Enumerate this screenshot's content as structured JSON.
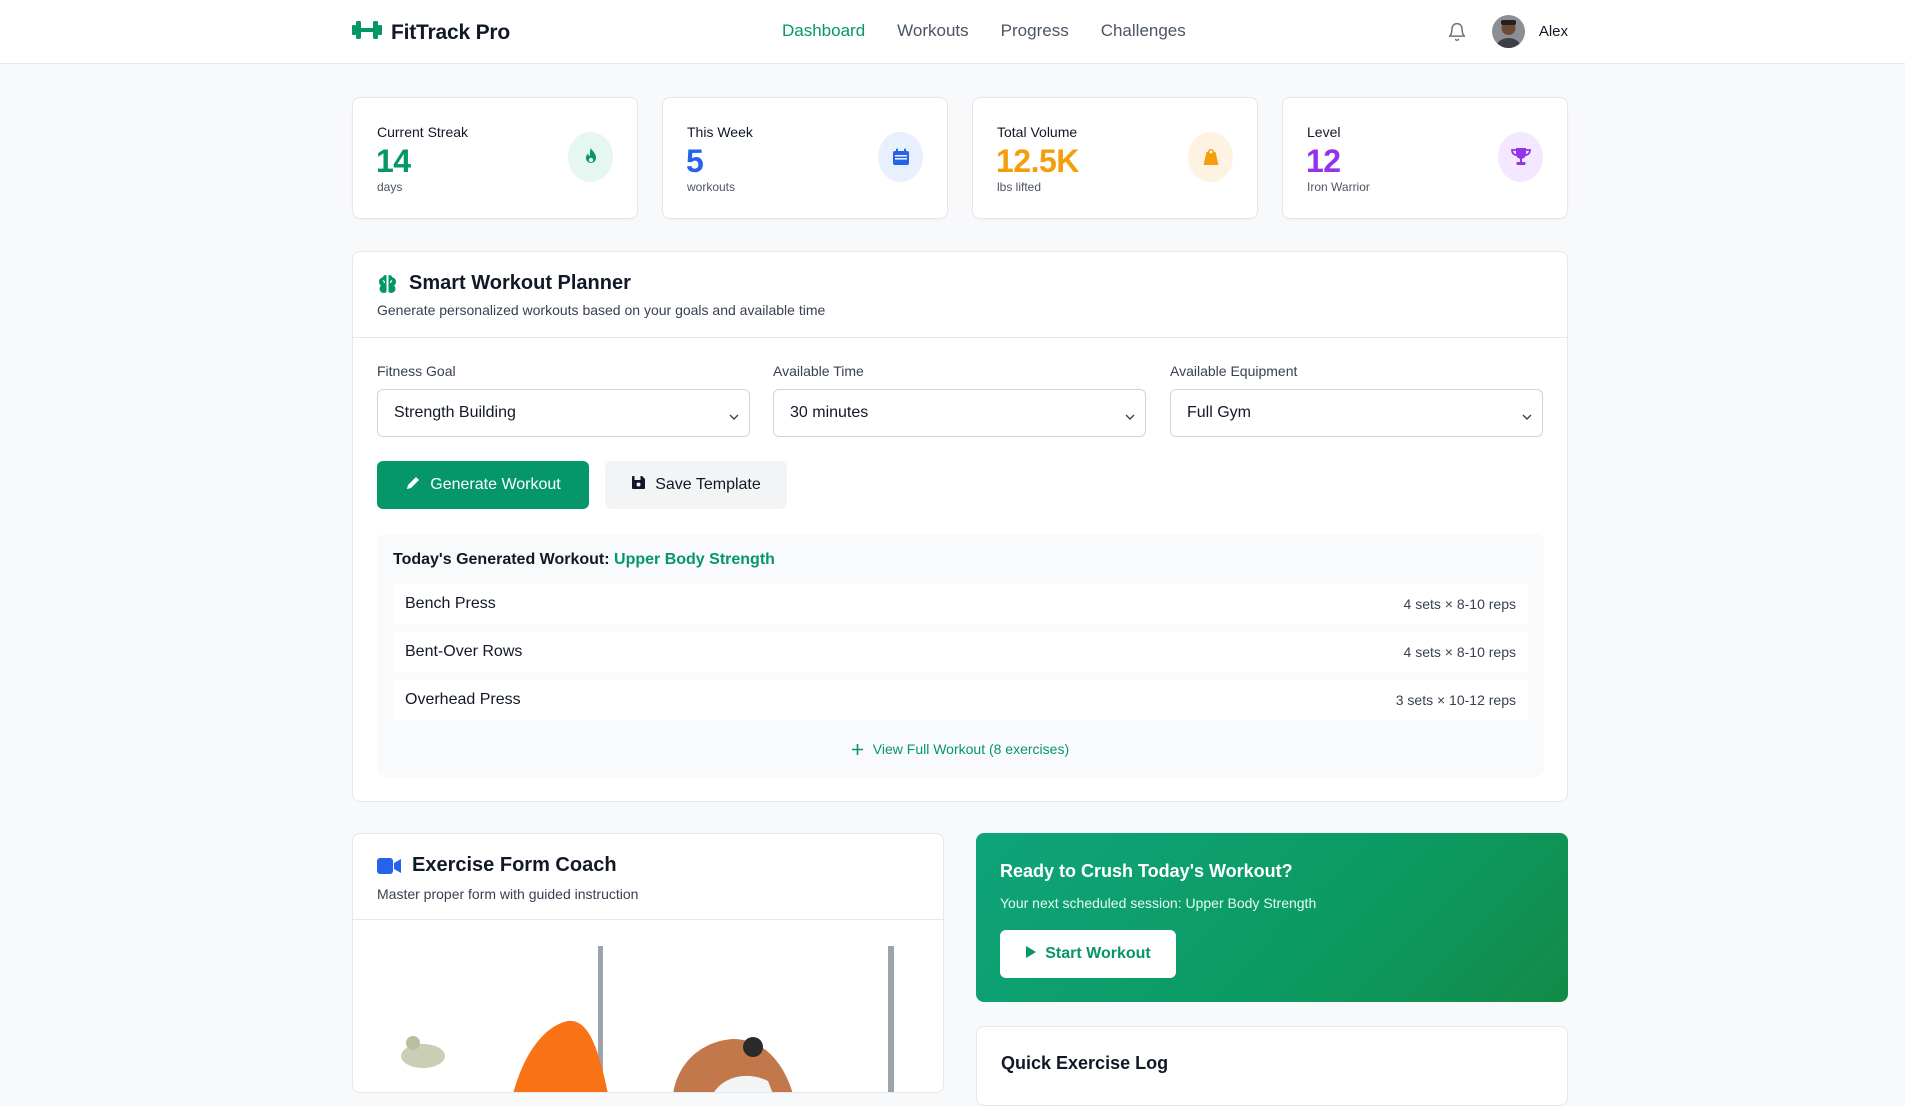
{
  "app": {
    "brand": "FitTrack Pro",
    "nav": [
      {
        "label": "Dashboard",
        "active": true
      },
      {
        "label": "Workouts",
        "active": false
      },
      {
        "label": "Progress",
        "active": false
      },
      {
        "label": "Challenges",
        "active": false
      }
    ],
    "user": {
      "name": "Alex"
    }
  },
  "stats": [
    {
      "label": "Current Streak",
      "value": "14",
      "unit": "days",
      "color": "#059669",
      "icon": "flame-icon"
    },
    {
      "label": "This Week",
      "value": "5",
      "unit": "workouts",
      "color": "#2563eb",
      "icon": "calendar-icon"
    },
    {
      "label": "Total Volume",
      "value": "12.5K",
      "unit": "lbs lifted",
      "color": "#f59e0b",
      "icon": "weight-icon"
    },
    {
      "label": "Level",
      "value": "12",
      "unit": "Iron Warrior",
      "color": "#9333ea",
      "icon": "trophy-icon"
    }
  ],
  "planner": {
    "title": "Smart Workout Planner",
    "subtitle": "Generate personalized workouts based on your goals and available time",
    "goal_label": "Fitness Goal",
    "goal_value": "Strength Building",
    "time_label": "Available Time",
    "time_value": "30 minutes",
    "equipment_label": "Available Equipment",
    "equipment_value": "Full Gym",
    "generate_label": "Generate Workout",
    "save_label": "Save Template",
    "generated_prefix": "Today's Generated Workout:",
    "generated_name": "Upper Body Strength",
    "exercises": [
      {
        "name": "Bench Press",
        "sets": "4 sets × 8-10 reps"
      },
      {
        "name": "Bent-Over Rows",
        "sets": "4 sets × 8-10 reps"
      },
      {
        "name": "Overhead Press",
        "sets": "3 sets × 10-12 reps"
      }
    ],
    "view_full": "View Full Workout (8 exercises)"
  },
  "coach": {
    "title": "Exercise Form Coach",
    "subtitle": "Master proper form with guided instruction"
  },
  "ready": {
    "title": "Ready to Crush Today's Workout?",
    "subtitle": "Your next scheduled session: Upper Body Strength",
    "start_label": "Start Workout"
  },
  "quicklog": {
    "title": "Quick Exercise Log"
  },
  "colors": {
    "accent": "#059669",
    "blue": "#2563eb",
    "amber": "#f59e0b",
    "purple": "#9333ea"
  }
}
